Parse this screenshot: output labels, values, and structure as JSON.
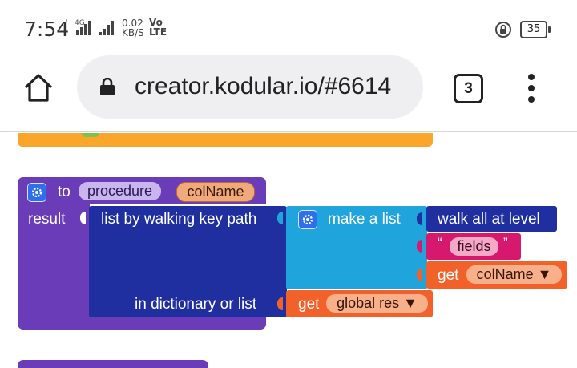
{
  "status_bar": {
    "time": "7:54",
    "network_small": "4G",
    "net_speed_value": "0.02",
    "net_speed_unit": "KB/S",
    "volte_top": "Vo",
    "volte_bottom": "LTE",
    "battery": "35"
  },
  "browser": {
    "url": "creator.kodular.io/#6614",
    "tab_count": "3"
  },
  "blocks": {
    "procedure_to": "to",
    "procedure_name": "procedure",
    "param_name": "colName",
    "result_label": "result",
    "walk_label": "list by walking key path",
    "dict_label": "in dictionary or list",
    "make_list_label": "make a list",
    "walk_level_label": "walk all at level",
    "quote_open": "“",
    "fields_text": "fields",
    "quote_close": "”",
    "get_label_1": "get",
    "get_var_1": "colName ▼",
    "get_label_2": "get",
    "get_var_2": "global res ▼"
  },
  "colors": {
    "procedure_purple": "#6a3cb8",
    "dictionary_blue": "#1f2fa0",
    "list_teal": "#1fa4dc",
    "variable_orange": "#f2612a",
    "text_magenta": "#d6186e",
    "control_orange": "#f9a62a"
  }
}
